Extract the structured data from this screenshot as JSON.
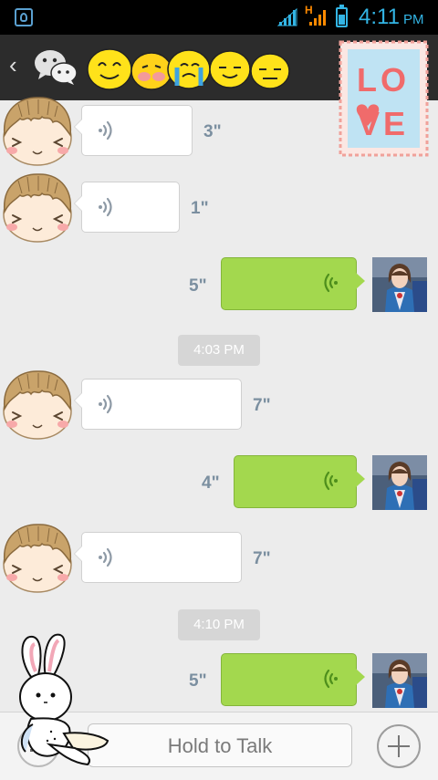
{
  "status_bar": {
    "time": "4:11",
    "ampm": "PM",
    "network_label": "H",
    "icons": [
      "app-shield-icon",
      "signal-icon",
      "signal-h-icon",
      "battery-charging-icon"
    ]
  },
  "title_bar": {
    "icons": [
      "back-arrow-icon",
      "wechat-logo-icon",
      "emoji-faces-sticker",
      "love-stamp-sticker"
    ],
    "stamp_text": "LOVE"
  },
  "messages": [
    {
      "from": "friend",
      "type": "voice",
      "duration": "3\""
    },
    {
      "from": "friend",
      "type": "voice",
      "duration": "1\""
    },
    {
      "from": "me",
      "type": "voice",
      "duration": "5\""
    },
    {
      "type": "timestamp",
      "text": "4:03 PM"
    },
    {
      "from": "friend",
      "type": "voice",
      "duration": "7\""
    },
    {
      "from": "me",
      "type": "voice",
      "duration": "4\""
    },
    {
      "from": "friend",
      "type": "voice",
      "duration": "7\""
    },
    {
      "type": "timestamp",
      "text": "4:10 PM"
    },
    {
      "from": "me",
      "type": "voice",
      "duration": "5\""
    }
  ],
  "input_bar": {
    "hold_to_talk": "Hold to Talk",
    "icons": [
      "keyboard-icon",
      "plus-icon"
    ]
  },
  "colors": {
    "outgoing_bubble": "#a3d84e",
    "incoming_bubble": "#ffffff",
    "status_text": "#33b5e5",
    "title_bar": "#2c2c2c"
  }
}
